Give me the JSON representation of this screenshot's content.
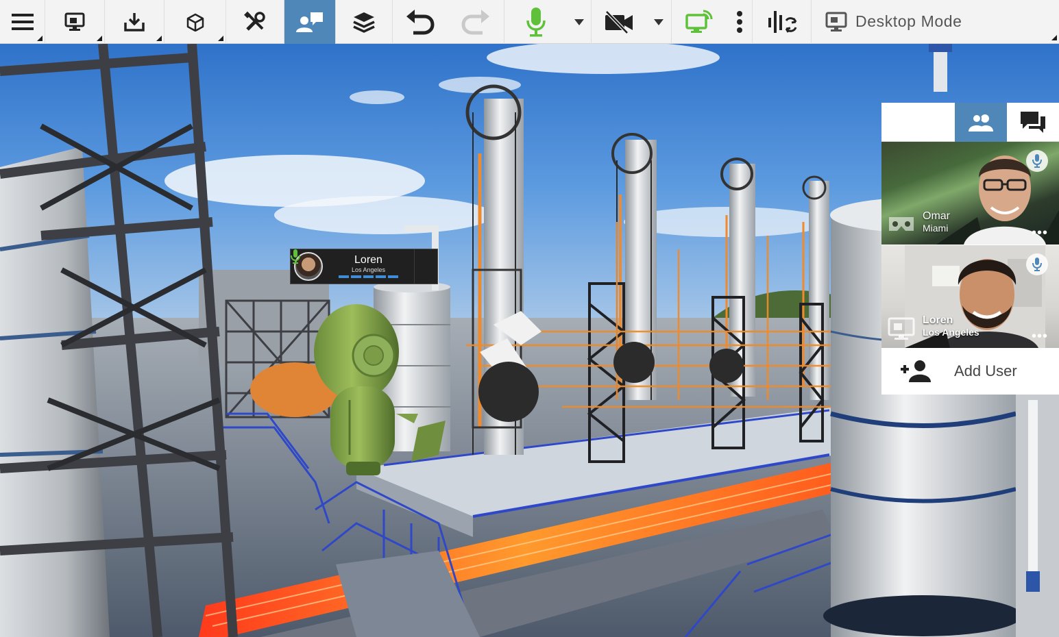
{
  "toolbar": {
    "buttons": [
      {
        "name": "menu",
        "icon": "hamburger-menu-icon",
        "has_submenu": true
      },
      {
        "name": "present",
        "icon": "monitor-icon",
        "has_submenu": true
      },
      {
        "name": "import",
        "icon": "download-icon",
        "has_submenu": true
      },
      {
        "name": "model",
        "icon": "cube-icon",
        "has_submenu": true
      },
      {
        "name": "tools",
        "icon": "tools-icon",
        "has_submenu": false
      },
      {
        "name": "collaboration",
        "icon": "user-chat-icon",
        "active": true
      },
      {
        "name": "layers",
        "icon": "layers-icon"
      },
      {
        "name": "undo",
        "icon": "undo-icon"
      },
      {
        "name": "redo",
        "icon": "redo-icon",
        "disabled": true
      },
      {
        "name": "microphone",
        "icon": "microphone-icon",
        "state": "on",
        "has_dropdown": true
      },
      {
        "name": "camera",
        "icon": "camera-off-icon",
        "state": "off",
        "has_dropdown": true
      },
      {
        "name": "screen-share",
        "icon": "cast-screen-icon",
        "state": "on"
      },
      {
        "name": "more",
        "icon": "more-vertical-icon"
      },
      {
        "name": "audio-settings",
        "icon": "audio-levels-icon"
      }
    ],
    "desktop_mode": {
      "label": "Desktop Mode",
      "icon": "desktop-icon"
    }
  },
  "avatar_tag": {
    "name": "Loren",
    "location": "Los Angeles",
    "mic_icon": "microphone-icon",
    "level_bars": 5
  },
  "participants_panel": {
    "tabs": [
      {
        "name": "users",
        "icon": "users-icon",
        "active": true
      },
      {
        "name": "chat",
        "icon": "chat-icon",
        "active": false
      }
    ],
    "participants": [
      {
        "name": "Omar",
        "location": "Miami",
        "device_icon": "vr-headset-icon",
        "mic_icon": "microphone-icon",
        "more": "•••"
      },
      {
        "name": "Loren",
        "location": "Los Angeles",
        "device_icon": "desktop-icon",
        "mic_icon": "microphone-icon",
        "more": "•••"
      }
    ],
    "add_user": {
      "label": "Add User",
      "icon": "add-user-icon"
    }
  },
  "colors": {
    "accent": "#4f87b8",
    "mic_on": "#5fc13a",
    "toolbar_bg": "#f3f3f3",
    "level_bar": "#3f8dd6"
  }
}
